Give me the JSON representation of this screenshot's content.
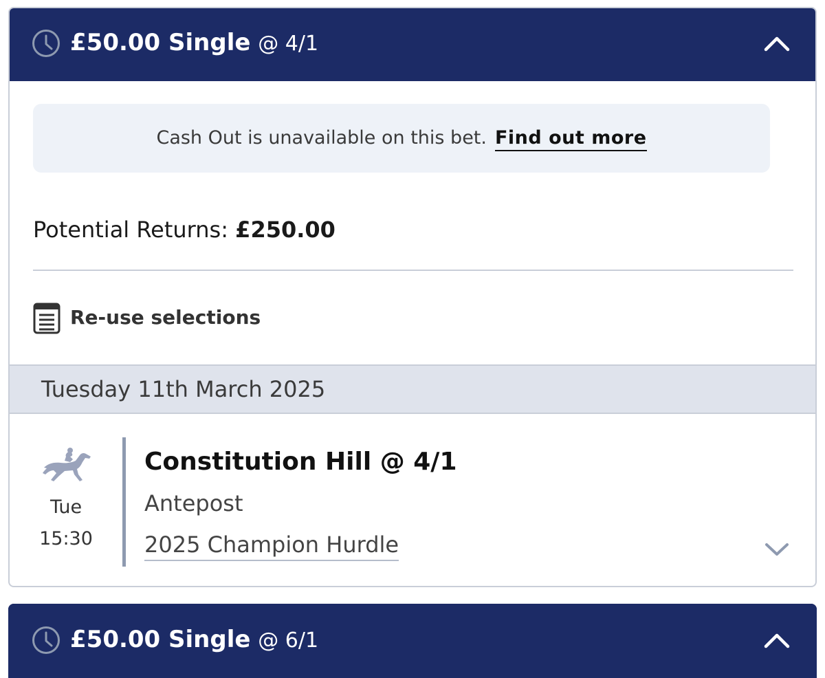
{
  "bet1": {
    "stake_type": "£50.00 Single",
    "odds": "@ 4/1",
    "cashout_notice": "Cash Out is unavailable on this bet.",
    "cashout_link": "Find out more",
    "returns_label": "Potential Returns:",
    "returns_value": "£250.00",
    "reuse_label": "Re-use selections",
    "date": "Tuesday 11th March 2025",
    "selection": {
      "day": "Tue",
      "time": "15:30",
      "name": "Constitution Hill @ 4/1",
      "market": "Antepost",
      "event": "2025 Champion Hurdle",
      "sport_icon": "horse-racing-icon"
    }
  },
  "bet2": {
    "stake_type": "£50.00 Single",
    "odds": "@ 6/1"
  },
  "colors": {
    "header_bg": "#1c2b66",
    "notice_bg": "#eef2f8",
    "date_bar_bg": "#dfe3ec",
    "accent_line": "#8e9ab0"
  }
}
